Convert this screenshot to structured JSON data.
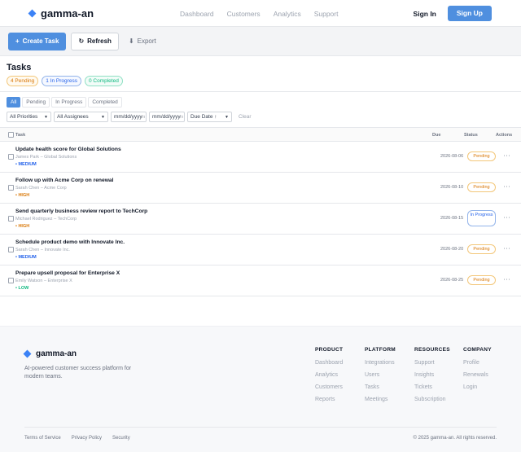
{
  "nav": {
    "brand": "gamma-an",
    "links": [
      "Dashboard",
      "Customers",
      "Analytics",
      "Support"
    ],
    "signin": "Sign In",
    "signup": "Sign Up"
  },
  "toolbar": {
    "create": "Create Task",
    "refresh": "Refresh",
    "export": "Export"
  },
  "tasks": {
    "title": "Tasks",
    "badges": {
      "pending": "4 Pending",
      "in_progress": "1 In Progress",
      "completed": "0 Completed"
    },
    "tabs": [
      "All",
      "Pending",
      "In Progress",
      "Completed"
    ],
    "filters": {
      "priorities": "All Priorities",
      "assignees": "All Assignees",
      "date_from": "mm/dd/yyyy",
      "date_to": "mm/dd/yyyy",
      "sort": "Due Date ↑",
      "clear": "Clear"
    },
    "columns": {
      "task": "Task",
      "due": "Due",
      "status": "Status",
      "actions": "Actions"
    },
    "rows": [
      {
        "title": "Update health score for Global Solutions",
        "sub": "James Park – Global Solutions",
        "priority": "• MEDIUM",
        "due": "2026-08-06",
        "status": "Pending"
      },
      {
        "title": "Follow up with Acme Corp on renewal",
        "sub": "Sarah Chen – Acme Corp",
        "priority": "• HIGH",
        "due": "2026-08-10",
        "status": "Pending"
      },
      {
        "title": "Send quarterly business review report to TechCorp",
        "sub": "Michael Rodriguez – TechCorp",
        "priority": "• HIGH",
        "due": "2026-08-15",
        "status": "In Progress"
      },
      {
        "title": "Schedule product demo with Innovate Inc.",
        "sub": "Sarah Chen – Innovate Inc.",
        "priority": "• MEDIUM",
        "due": "2026-08-20",
        "status": "Pending"
      },
      {
        "title": "Prepare upsell proposal for Enterprise X",
        "sub": "Emily Watson – Enterprise X",
        "priority": "• LOW",
        "due": "2026-08-25",
        "status": "Pending"
      }
    ],
    "action_icon": "⋯"
  },
  "footer": {
    "brand": "gamma-an",
    "description": "AI-powered customer success platform for modern teams.",
    "columns": [
      {
        "heading": "PRODUCT",
        "links": [
          "Dashboard",
          "Analytics",
          "Customers",
          "Reports"
        ]
      },
      {
        "heading": "PLATFORM",
        "links": [
          "Integrations",
          "Users",
          "Tasks",
          "Meetings"
        ]
      },
      {
        "heading": "RESOURCES",
        "links": [
          "Support",
          "Insights",
          "Tickets",
          "Subscription"
        ]
      },
      {
        "heading": "COMPANY",
        "links": [
          "Profile",
          "Renewals",
          "Login"
        ]
      }
    ],
    "legal": [
      "Terms of Service",
      "Privacy Policy",
      "Security"
    ],
    "copyright": "© 2025 gamma-an. All rights reserved."
  },
  "colors": {
    "accent": "#4f8fdf",
    "medium": "#2563eb",
    "high": "#d97706",
    "low": "#10b981"
  }
}
